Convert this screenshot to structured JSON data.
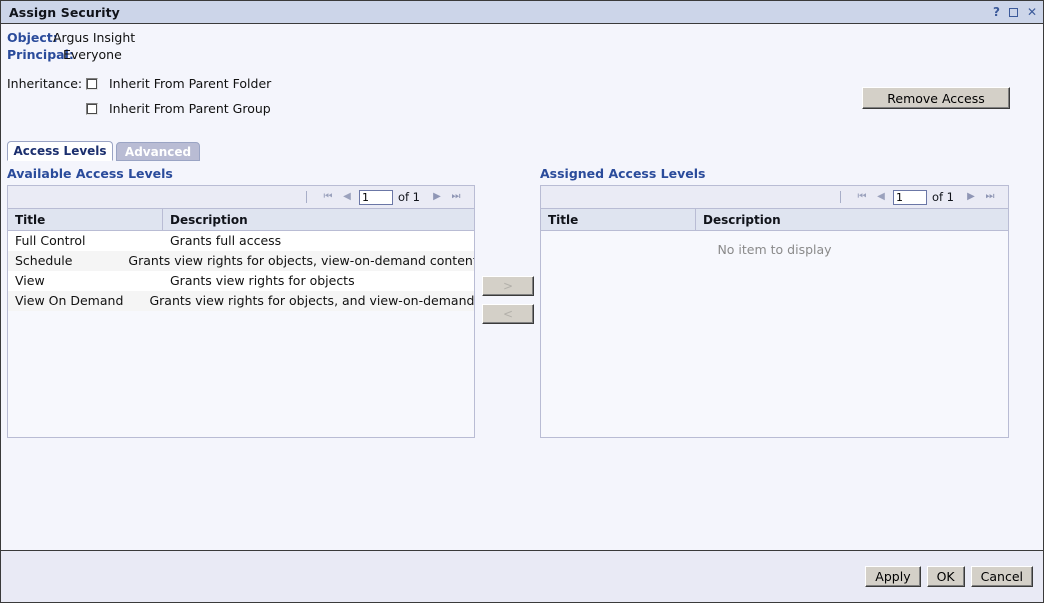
{
  "window": {
    "title": "Assign Security",
    "controls": [
      {
        "name": "help-icon",
        "label": "?"
      },
      {
        "name": "maximize-icon",
        "label": ""
      },
      {
        "name": "close-icon",
        "label": "✕"
      }
    ]
  },
  "info": {
    "object_label": "Object:",
    "object_value": "Argus Insight",
    "principal_label": "Principal:",
    "principal_value": "Everyone"
  },
  "inheritance": {
    "caption": "Inheritance:",
    "options": [
      {
        "label": "Inherit From Parent Folder",
        "checked": false
      },
      {
        "label": "Inherit From Parent Group",
        "checked": false
      }
    ]
  },
  "actions": {
    "remove_access": "Remove Access"
  },
  "tabs": [
    {
      "label": "Access Levels",
      "active": true
    },
    {
      "label": "Advanced",
      "active": false
    }
  ],
  "available": {
    "title": "Available Access Levels",
    "pager": {
      "page_value": "1",
      "of_text": "of 1"
    },
    "columns": [
      "Title",
      "Description"
    ],
    "rows": [
      {
        "title": "Full Control",
        "description": "Grants full access"
      },
      {
        "title": "Schedule",
        "description": "Grants view rights for objects, view-on-demand content, and schedule rights"
      },
      {
        "title": "View",
        "description": "Grants view rights for objects"
      },
      {
        "title": "View On Demand",
        "description": "Grants view rights for objects, and view-on-demand content"
      }
    ]
  },
  "assigned": {
    "title": "Assigned Access Levels",
    "pager": {
      "page_value": "1",
      "of_text": "of 1"
    },
    "columns": [
      "Title",
      "Description"
    ],
    "rows": [],
    "empty_message": "No item to display"
  },
  "transfer": {
    "add_label": ">",
    "remove_label": "<"
  },
  "footer": {
    "apply": "Apply",
    "ok": "OK",
    "cancel": "Cancel"
  },
  "icons": {
    "first_page": "⏮",
    "prev_page": "◀",
    "next_page": "▶",
    "last_page": "⏭"
  }
}
